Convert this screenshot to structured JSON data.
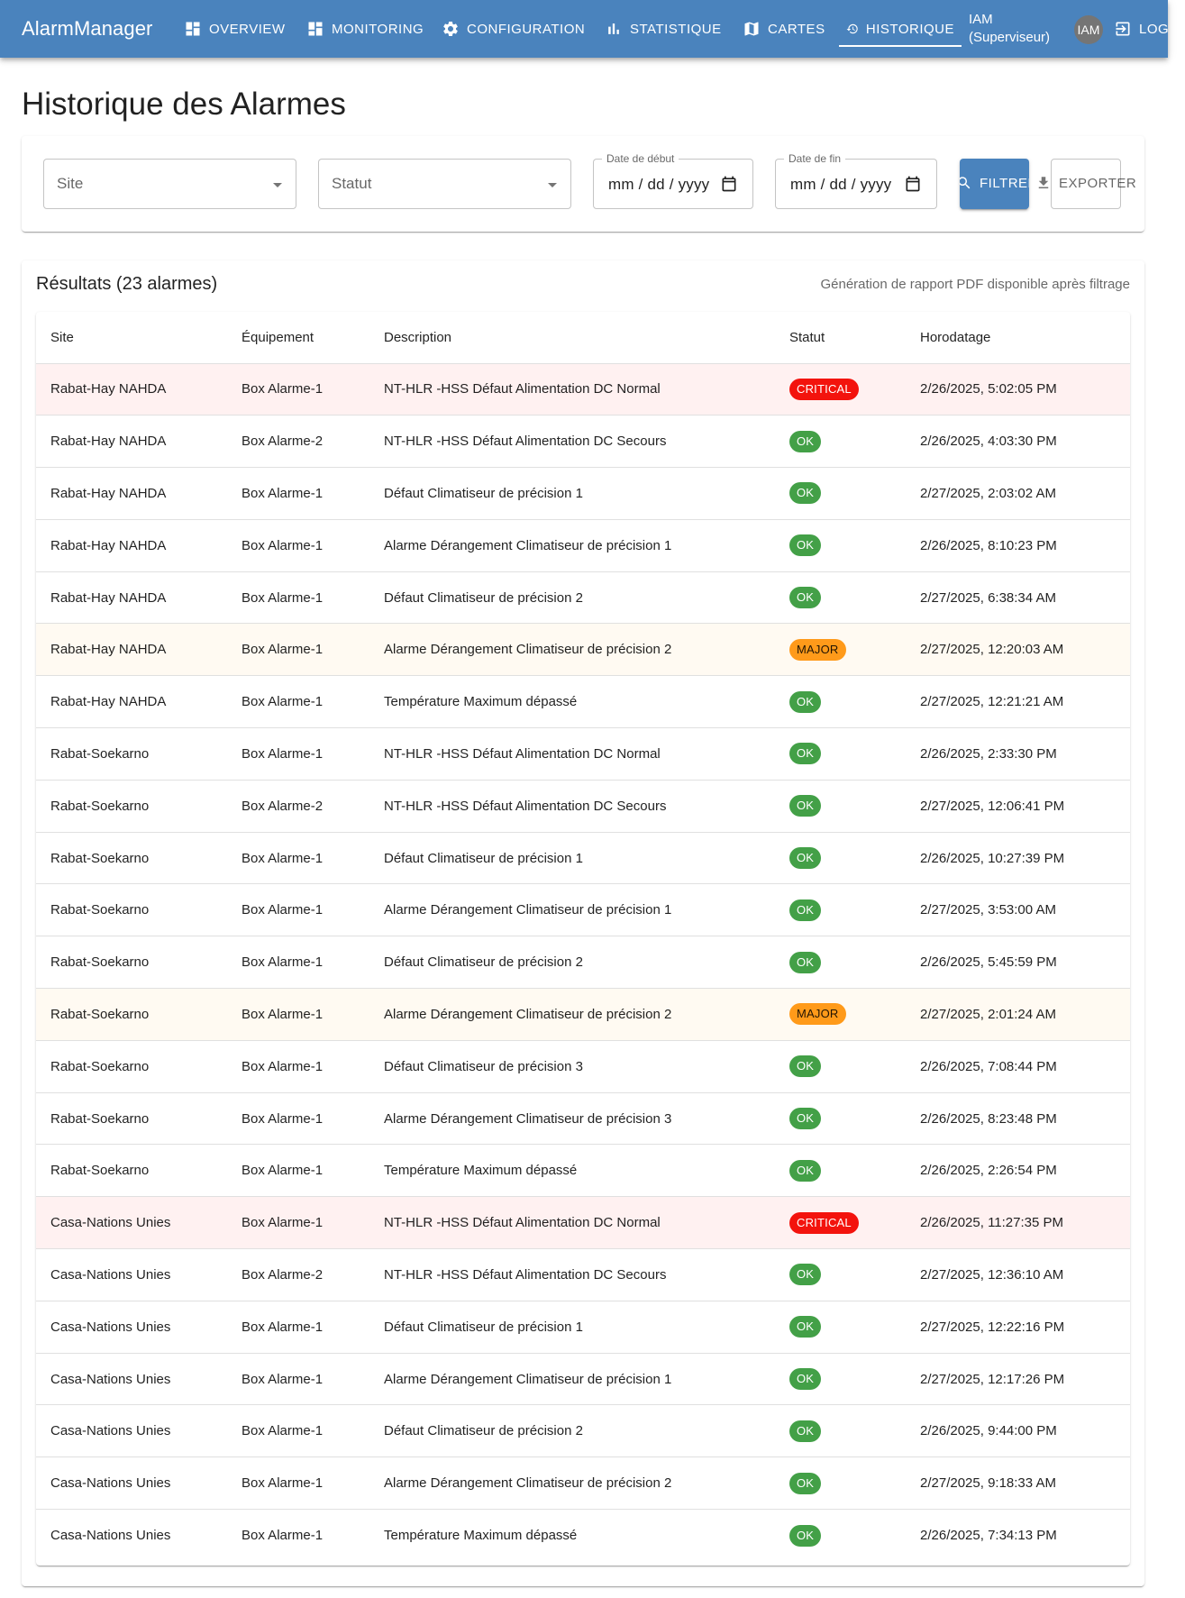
{
  "app": {
    "brand": "AlarmManager",
    "nav": [
      {
        "label": "OVERVIEW",
        "icon": "dashboard-icon"
      },
      {
        "label": "MONITORING",
        "icon": "dashboard-icon"
      },
      {
        "label": "CONFIGURATION",
        "icon": "gear-icon"
      },
      {
        "label": "STATISTIQUE",
        "icon": "bar-chart-icon"
      },
      {
        "label": "CARTES",
        "icon": "map-icon"
      },
      {
        "label": "HISTORIQUE",
        "icon": "history-icon",
        "active": true
      }
    ],
    "user": {
      "name": "IAM",
      "role": "(Superviseur)",
      "avatar": "IAM"
    },
    "logout_label": "LOGOUT"
  },
  "page": {
    "title": "Historique des Alarmes"
  },
  "filters": {
    "site_placeholder": "Site",
    "status_placeholder": "Statut",
    "start_label": "Date de début",
    "start_value": "mm / dd / yyyy",
    "end_label": "Date de fin",
    "end_value": "mm / dd / yyyy",
    "filter_label": "FILTRER",
    "export_label": "EXPORTER"
  },
  "results": {
    "title": "Résultats (23 alarmes)",
    "note": "Génération de rapport PDF disponible après filtrage",
    "columns": [
      "Site",
      "Équipement",
      "Description",
      "Statut",
      "Horodatage"
    ],
    "rows": [
      {
        "site": "Rabat-Hay NAHDA",
        "equipment": "Box Alarme-1",
        "description": "NT-HLR -HSS Défaut Alimentation DC Normal",
        "status": "CRITICAL",
        "timestamp": "2/26/2025, 5:02:05 PM"
      },
      {
        "site": "Rabat-Hay NAHDA",
        "equipment": "Box Alarme-2",
        "description": "NT-HLR -HSS Défaut Alimentation DC Secours",
        "status": "OK",
        "timestamp": "2/26/2025, 4:03:30 PM"
      },
      {
        "site": "Rabat-Hay NAHDA",
        "equipment": "Box Alarme-1",
        "description": "Défaut Climatiseur de précision 1",
        "status": "OK",
        "timestamp": "2/27/2025, 2:03:02 AM"
      },
      {
        "site": "Rabat-Hay NAHDA",
        "equipment": "Box Alarme-1",
        "description": "Alarme Dérangement Climatiseur de précision 1",
        "status": "OK",
        "timestamp": "2/26/2025, 8:10:23 PM"
      },
      {
        "site": "Rabat-Hay NAHDA",
        "equipment": "Box Alarme-1",
        "description": "Défaut Climatiseur de précision 2",
        "status": "OK",
        "timestamp": "2/27/2025, 6:38:34 AM"
      },
      {
        "site": "Rabat-Hay NAHDA",
        "equipment": "Box Alarme-1",
        "description": "Alarme Dérangement Climatiseur de précision 2",
        "status": "MAJOR",
        "timestamp": "2/27/2025, 12:20:03 AM"
      },
      {
        "site": "Rabat-Hay NAHDA",
        "equipment": "Box Alarme-1",
        "description": "Température Maximum dépassé",
        "status": "OK",
        "timestamp": "2/27/2025, 12:21:21 AM"
      },
      {
        "site": "Rabat-Soekarno",
        "equipment": "Box Alarme-1",
        "description": "NT-HLR -HSS Défaut Alimentation DC Normal",
        "status": "OK",
        "timestamp": "2/26/2025, 2:33:30 PM"
      },
      {
        "site": "Rabat-Soekarno",
        "equipment": "Box Alarme-2",
        "description": "NT-HLR -HSS Défaut Alimentation DC Secours",
        "status": "OK",
        "timestamp": "2/27/2025, 12:06:41 PM"
      },
      {
        "site": "Rabat-Soekarno",
        "equipment": "Box Alarme-1",
        "description": "Défaut Climatiseur de précision 1",
        "status": "OK",
        "timestamp": "2/26/2025, 10:27:39 PM"
      },
      {
        "site": "Rabat-Soekarno",
        "equipment": "Box Alarme-1",
        "description": "Alarme Dérangement Climatiseur de précision 1",
        "status": "OK",
        "timestamp": "2/27/2025, 3:53:00 AM"
      },
      {
        "site": "Rabat-Soekarno",
        "equipment": "Box Alarme-1",
        "description": "Défaut Climatiseur de précision 2",
        "status": "OK",
        "timestamp": "2/26/2025, 5:45:59 PM"
      },
      {
        "site": "Rabat-Soekarno",
        "equipment": "Box Alarme-1",
        "description": "Alarme Dérangement Climatiseur de précision 2",
        "status": "MAJOR",
        "timestamp": "2/27/2025, 2:01:24 AM"
      },
      {
        "site": "Rabat-Soekarno",
        "equipment": "Box Alarme-1",
        "description": "Défaut Climatiseur de précision 3",
        "status": "OK",
        "timestamp": "2/26/2025, 7:08:44 PM"
      },
      {
        "site": "Rabat-Soekarno",
        "equipment": "Box Alarme-1",
        "description": "Alarme Dérangement Climatiseur de précision 3",
        "status": "OK",
        "timestamp": "2/26/2025, 8:23:48 PM"
      },
      {
        "site": "Rabat-Soekarno",
        "equipment": "Box Alarme-1",
        "description": "Température Maximum dépassé",
        "status": "OK",
        "timestamp": "2/26/2025, 2:26:54 PM"
      },
      {
        "site": "Casa-Nations Unies",
        "equipment": "Box Alarme-1",
        "description": "NT-HLR -HSS Défaut Alimentation DC Normal",
        "status": "CRITICAL",
        "timestamp": "2/26/2025, 11:27:35 PM"
      },
      {
        "site": "Casa-Nations Unies",
        "equipment": "Box Alarme-2",
        "description": "NT-HLR -HSS Défaut Alimentation DC Secours",
        "status": "OK",
        "timestamp": "2/27/2025, 12:36:10 AM"
      },
      {
        "site": "Casa-Nations Unies",
        "equipment": "Box Alarme-1",
        "description": "Défaut Climatiseur de précision 1",
        "status": "OK",
        "timestamp": "2/27/2025, 12:22:16 PM"
      },
      {
        "site": "Casa-Nations Unies",
        "equipment": "Box Alarme-1",
        "description": "Alarme Dérangement Climatiseur de précision 1",
        "status": "OK",
        "timestamp": "2/27/2025, 12:17:26 PM"
      },
      {
        "site": "Casa-Nations Unies",
        "equipment": "Box Alarme-1",
        "description": "Défaut Climatiseur de précision 2",
        "status": "OK",
        "timestamp": "2/26/2025, 9:44:00 PM"
      },
      {
        "site": "Casa-Nations Unies",
        "equipment": "Box Alarme-1",
        "description": "Alarme Dérangement Climatiseur de précision 2",
        "status": "OK",
        "timestamp": "2/27/2025, 9:18:33 AM"
      },
      {
        "site": "Casa-Nations Unies",
        "equipment": "Box Alarme-1",
        "description": "Température Maximum dépassé",
        "status": "OK",
        "timestamp": "2/26/2025, 7:34:13 PM"
      }
    ]
  },
  "colors": {
    "primary": "#4a83bd",
    "ok": "#43a047",
    "critical": "#f3130d",
    "major": "#ff9a1a",
    "critical_row": "#fff1f1",
    "major_row": "#fffaf2"
  }
}
